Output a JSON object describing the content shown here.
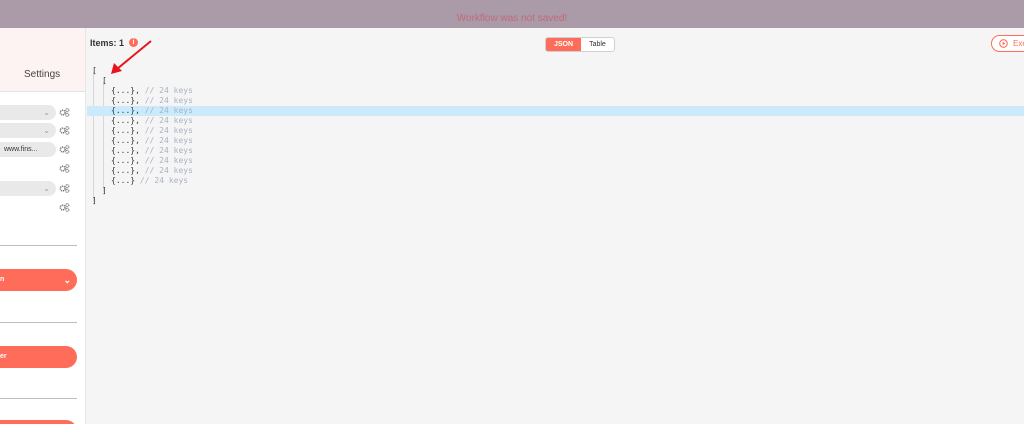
{
  "banner": {
    "message": "Workflow was not saved!"
  },
  "left_panel": {
    "settings_tab": "Settings",
    "params": [
      {
        "value": "",
        "has_dropdown": true
      },
      {
        "value": "",
        "has_dropdown": true
      },
      {
        "value": "www.fins...",
        "has_dropdown": false
      },
      {
        "value": "",
        "has_dropdown": true
      }
    ],
    "buttons": [
      {
        "label": "n",
        "has_dropdown": true
      },
      {
        "label": "er",
        "has_dropdown": false
      }
    ]
  },
  "output": {
    "items_label": "Items: 1",
    "info_icon": "i",
    "view_toggle": {
      "json_label": "JSON",
      "table_label": "Table",
      "active": "JSON"
    },
    "execute_button": "Exe",
    "json": {
      "open_outer": "[",
      "open_inner": "[",
      "rows": [
        {
          "text": "{...},",
          "comment": "// 24 keys"
        },
        {
          "text": "{...},",
          "comment": "// 24 keys"
        },
        {
          "text": "{...},",
          "comment": "// 24 keys"
        },
        {
          "text": "{...},",
          "comment": "// 24 keys"
        },
        {
          "text": "{...},",
          "comment": "// 24 keys"
        },
        {
          "text": "{...},",
          "comment": "// 24 keys"
        },
        {
          "text": "{...},",
          "comment": "// 24 keys"
        },
        {
          "text": "{...},",
          "comment": "// 24 keys"
        },
        {
          "text": "{...},",
          "comment": "// 24 keys"
        },
        {
          "text": "{...}",
          "comment": "// 24 keys"
        }
      ],
      "close_inner": "]",
      "close_outer": "]"
    }
  },
  "colors": {
    "accent": "#ff6d5a",
    "banner": "#ab9aa8",
    "highlight": "#cbeafb",
    "annotation_arrow": "#e8141c"
  }
}
